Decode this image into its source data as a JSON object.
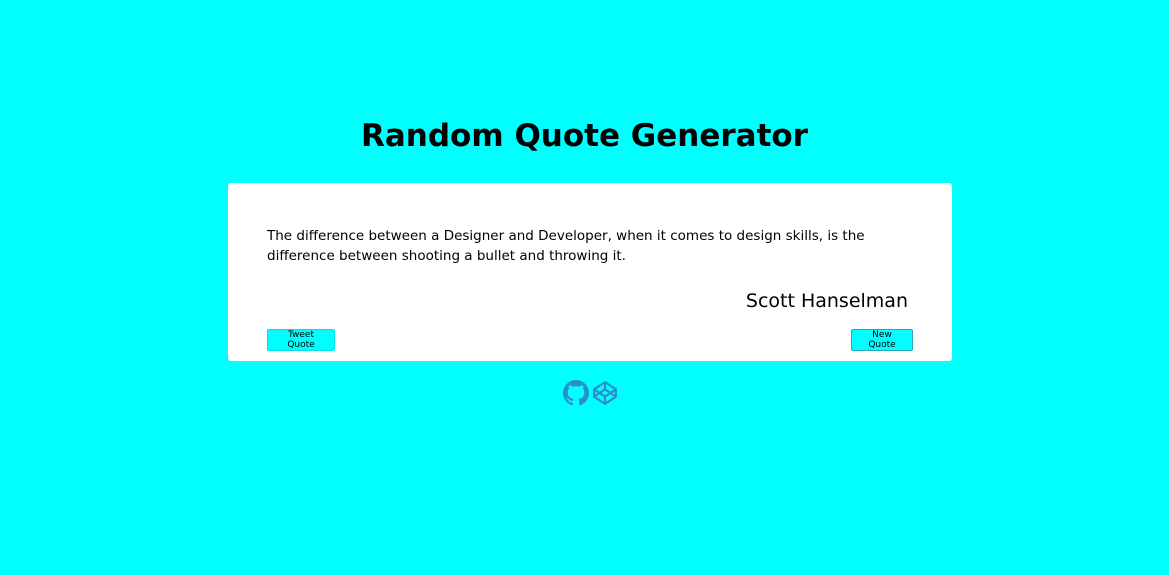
{
  "page": {
    "title": "Random Quote Generator"
  },
  "quote": {
    "text": "The difference between a Designer and Developer, when it comes to design skills, is the difference between shooting a bullet and throwing it.",
    "author": "Scott Hanselman"
  },
  "buttons": {
    "tweet_label": "Tweet Quote",
    "new_label": "New Quote"
  },
  "social": {
    "icons": [
      "github-icon",
      "codepen-icon"
    ]
  },
  "colors": {
    "background": "#00ffff",
    "card": "#ffffff",
    "icon": "#2a8fc9"
  }
}
